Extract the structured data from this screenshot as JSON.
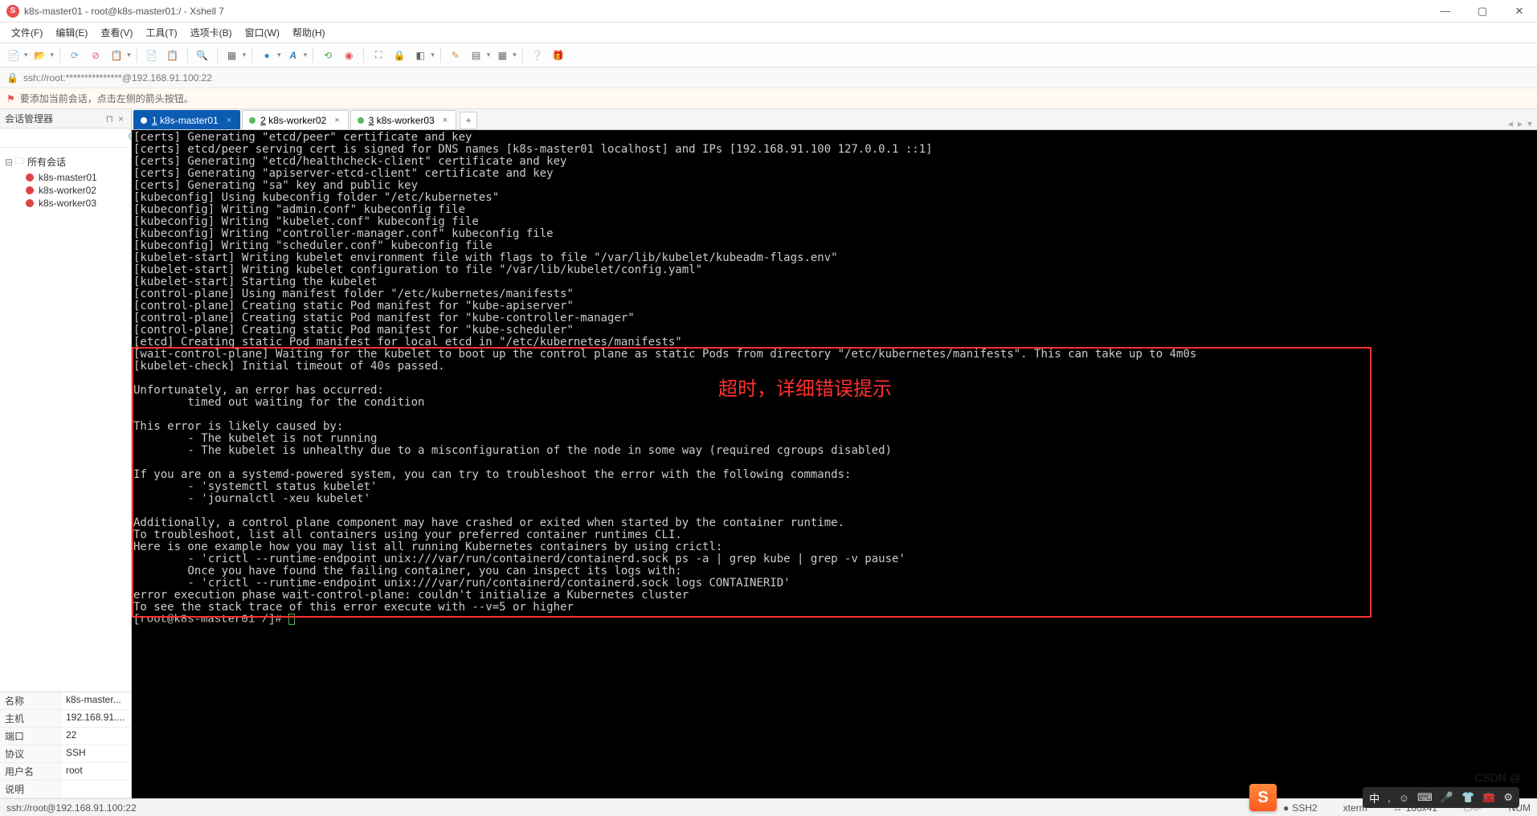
{
  "window": {
    "title": "k8s-master01 - root@k8s-master01:/ - Xshell 7"
  },
  "menu": [
    "文件(F)",
    "编辑(E)",
    "查看(V)",
    "工具(T)",
    "选项卡(B)",
    "窗口(W)",
    "帮助(H)"
  ],
  "address": {
    "text": "ssh://root:***************@192.168.91.100:22"
  },
  "tip": {
    "text": "要添加当前会话，点击左侧的箭头按钮。"
  },
  "sidebar": {
    "title": "会话管理器",
    "root": "所有会话",
    "items": [
      {
        "name": "k8s-master01",
        "color": "#d44"
      },
      {
        "name": "k8s-worker02",
        "color": "#d44"
      },
      {
        "name": "k8s-worker03",
        "color": "#d44"
      }
    ]
  },
  "properties": [
    {
      "k": "名称",
      "v": "k8s-master..."
    },
    {
      "k": "主机",
      "v": "192.168.91...."
    },
    {
      "k": "端口",
      "v": "22"
    },
    {
      "k": "协议",
      "v": "SSH"
    },
    {
      "k": "用户名",
      "v": "root"
    },
    {
      "k": "说明",
      "v": ""
    }
  ],
  "tabs": [
    {
      "num": "1",
      "label": "k8s-master01",
      "active": true,
      "dot": "#fff"
    },
    {
      "num": "2",
      "label": "k8s-worker02",
      "active": false,
      "dot": "#5cb85c"
    },
    {
      "num": "3",
      "label": "k8s-worker03",
      "active": false,
      "dot": "#5cb85c"
    }
  ],
  "terminal_lines": [
    "[certs] Generating \"etcd/peer\" certificate and key",
    "[certs] etcd/peer serving cert is signed for DNS names [k8s-master01 localhost] and IPs [192.168.91.100 127.0.0.1 ::1]",
    "[certs] Generating \"etcd/healthcheck-client\" certificate and key",
    "[certs] Generating \"apiserver-etcd-client\" certificate and key",
    "[certs] Generating \"sa\" key and public key",
    "[kubeconfig] Using kubeconfig folder \"/etc/kubernetes\"",
    "[kubeconfig] Writing \"admin.conf\" kubeconfig file",
    "[kubeconfig] Writing \"kubelet.conf\" kubeconfig file",
    "[kubeconfig] Writing \"controller-manager.conf\" kubeconfig file",
    "[kubeconfig] Writing \"scheduler.conf\" kubeconfig file",
    "[kubelet-start] Writing kubelet environment file with flags to file \"/var/lib/kubelet/kubeadm-flags.env\"",
    "[kubelet-start] Writing kubelet configuration to file \"/var/lib/kubelet/config.yaml\"",
    "[kubelet-start] Starting the kubelet",
    "[control-plane] Using manifest folder \"/etc/kubernetes/manifests\"",
    "[control-plane] Creating static Pod manifest for \"kube-apiserver\"",
    "[control-plane] Creating static Pod manifest for \"kube-controller-manager\"",
    "[control-plane] Creating static Pod manifest for \"kube-scheduler\"",
    "[etcd] Creating static Pod manifest for local etcd in \"/etc/kubernetes/manifests\"",
    "[wait-control-plane] Waiting for the kubelet to boot up the control plane as static Pods from directory \"/etc/kubernetes/manifests\". This can take up to 4m0s",
    "[kubelet-check] Initial timeout of 40s passed.",
    "",
    "Unfortunately, an error has occurred:",
    "        timed out waiting for the condition",
    "",
    "This error is likely caused by:",
    "        - The kubelet is not running",
    "        - The kubelet is unhealthy due to a misconfiguration of the node in some way (required cgroups disabled)",
    "",
    "If you are on a systemd-powered system, you can try to troubleshoot the error with the following commands:",
    "        - 'systemctl status kubelet'",
    "        - 'journalctl -xeu kubelet'",
    "",
    "Additionally, a control plane component may have crashed or exited when started by the container runtime.",
    "To troubleshoot, list all containers using your preferred container runtimes CLI.",
    "Here is one example how you may list all running Kubernetes containers by using crictl:",
    "        - 'crictl --runtime-endpoint unix:///var/run/containerd/containerd.sock ps -a | grep kube | grep -v pause'",
    "        Once you have found the failing container, you can inspect its logs with:",
    "        - 'crictl --runtime-endpoint unix:///var/run/containerd/containerd.sock logs CONTAINERID'",
    "error execution phase wait-control-plane: couldn't initialize a Kubernetes cluster",
    "To see the stack trace of this error execute with --v=5 or higher"
  ],
  "prompt": "[root@k8s-master01 /]# ",
  "annotation": "超时，详细错误提示",
  "status": {
    "left": "ssh://root@192.168.91.100:22",
    "ssh": "SSH2",
    "term": "xterm",
    "size": "186x41",
    "caps": "CAP",
    "num": "NUM"
  },
  "ime": {
    "zh": "中",
    "half": "•)"
  },
  "watermark": "CSDN @"
}
